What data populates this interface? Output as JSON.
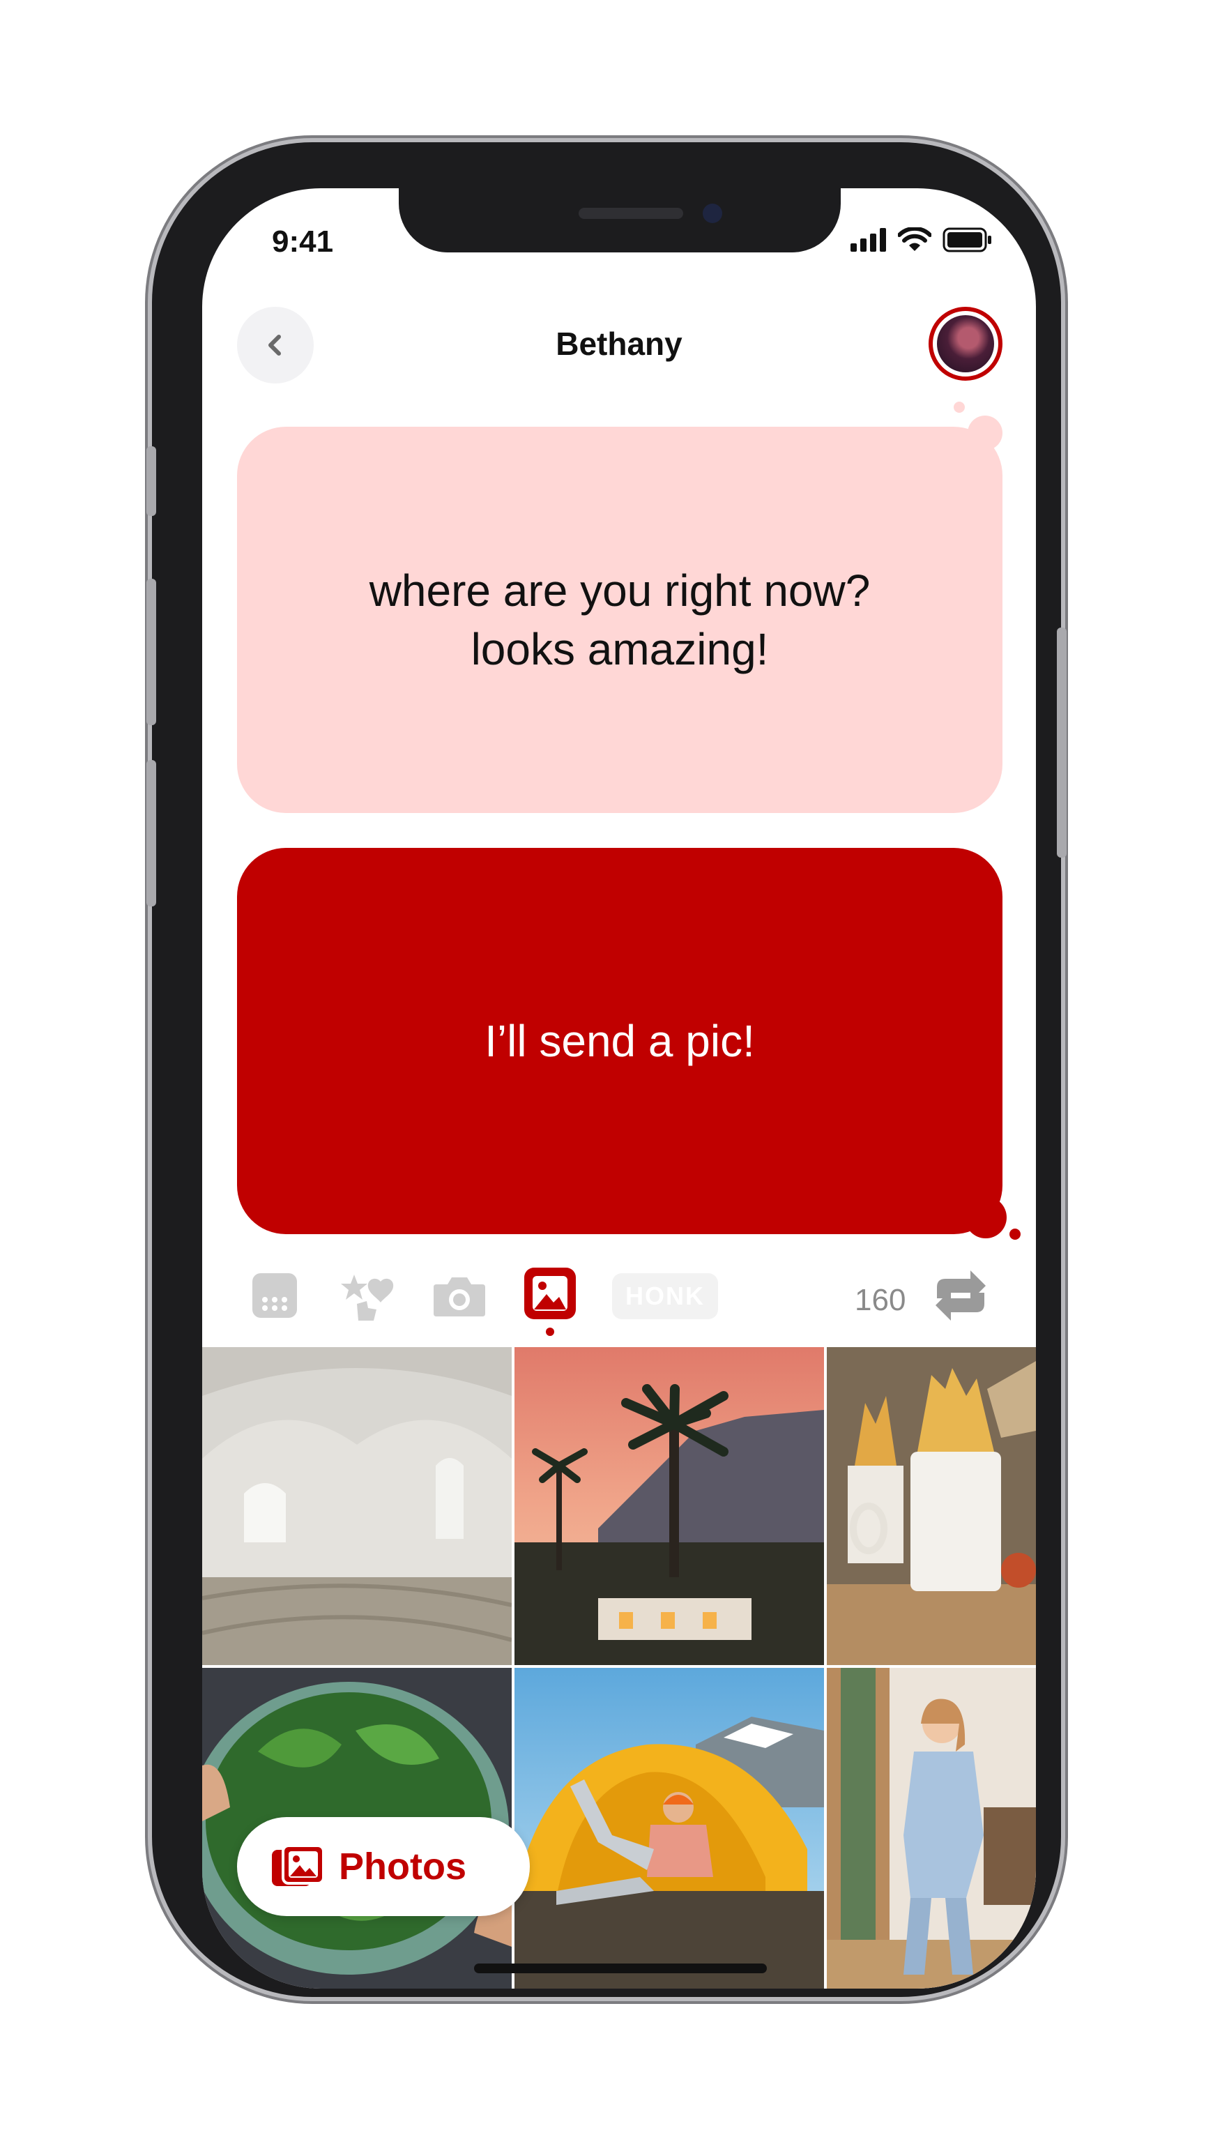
{
  "status_bar": {
    "time": "9:41",
    "signal_icon": "signal-icon",
    "wifi_icon": "wifi-icon",
    "battery_icon": "battery-icon"
  },
  "header": {
    "title": "Bethany",
    "back_icon": "chevron-left-icon",
    "avatar": "avatar"
  },
  "messages": [
    {
      "direction": "incoming",
      "text": "where are you right now?\nlooks amazing!"
    },
    {
      "direction": "outgoing",
      "text": "I’ll send a pic!"
    }
  ],
  "toolbar": {
    "items": [
      "keyboard-icon",
      "stickers-icon",
      "camera-icon",
      "photos-icon",
      "honk-icon"
    ],
    "selected": "photos-icon",
    "honk_label": "HONK",
    "count": "160",
    "refresh_icon": "refresh-icon"
  },
  "photos": [
    "arched-room-photo",
    "palm-tree-sunset-photo",
    "fries-mugs-photo",
    "spinach-bowl-photo",
    "tent-camper-photo",
    "woman-window-photo"
  ],
  "photos_button": {
    "label": "Photos"
  },
  "colors": {
    "accent": "#c00000",
    "incoming_bubble": "#ffd7d6",
    "muted": "#c8c8c8",
    "count_text": "#8a8a8a"
  }
}
